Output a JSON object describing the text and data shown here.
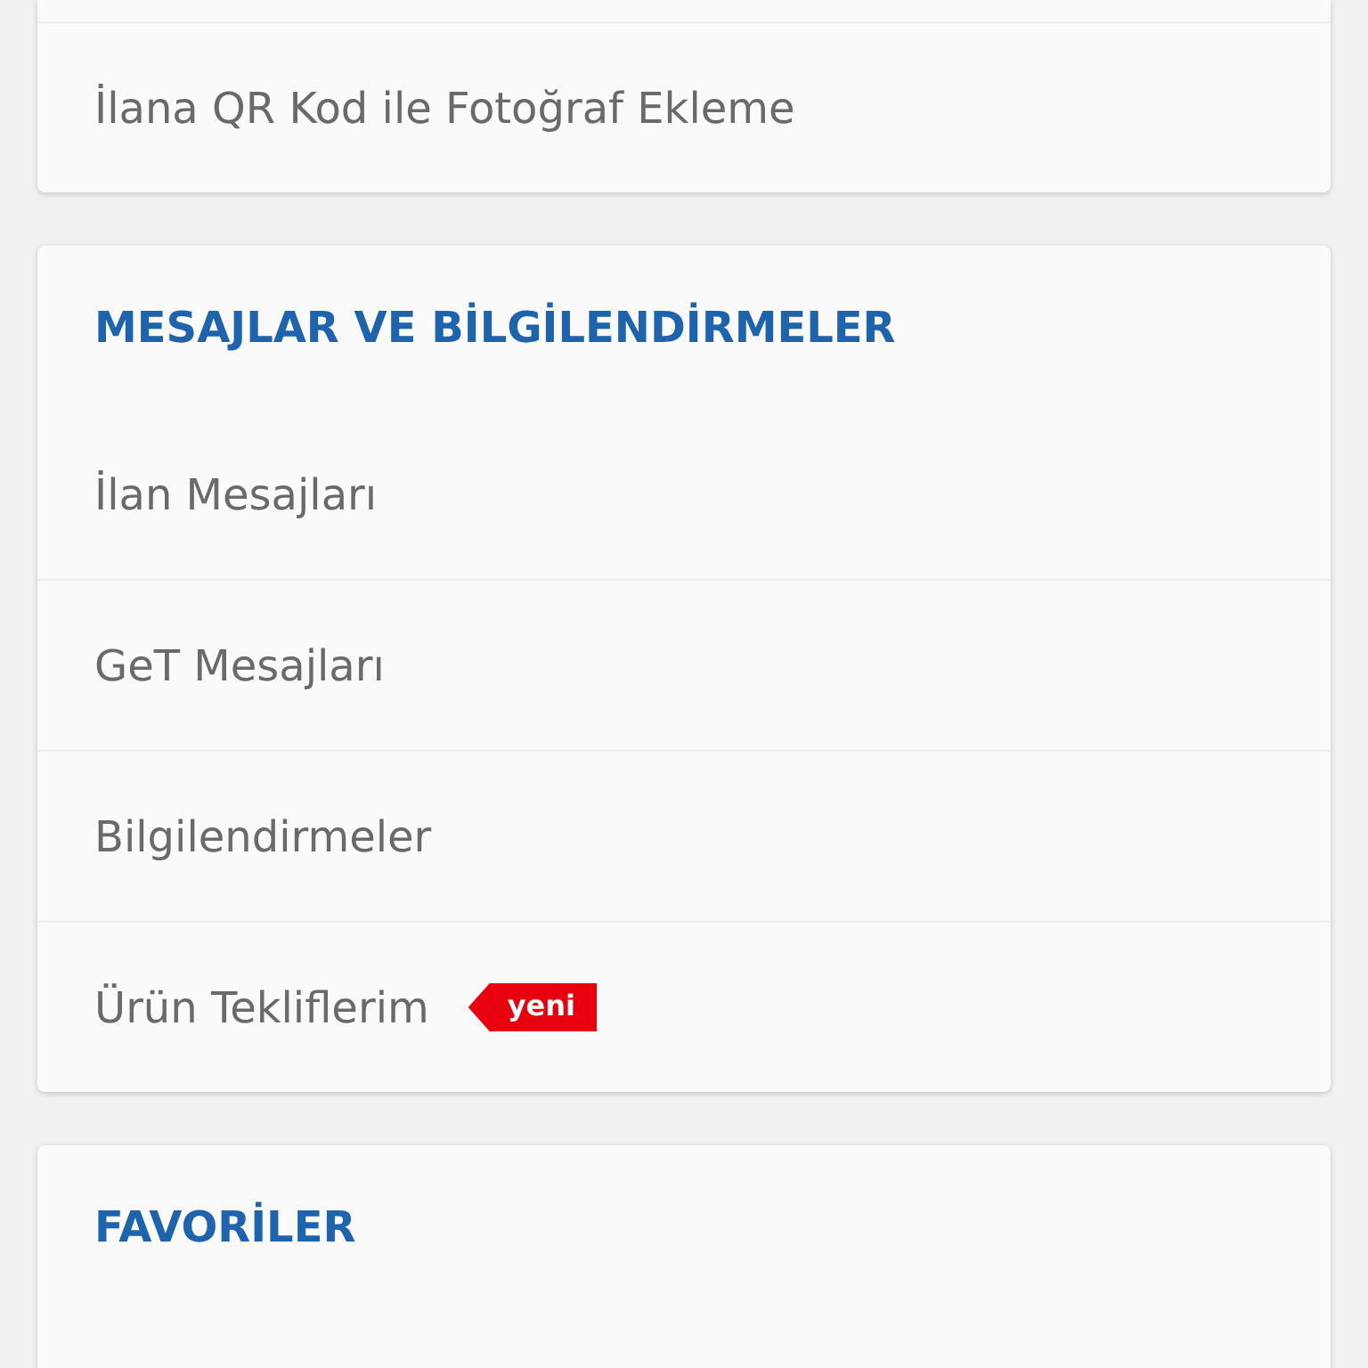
{
  "sections": [
    {
      "items": [
        {
          "label": "İlana QR Kod ile Fotoğraf Ekleme"
        }
      ]
    },
    {
      "title": "MESAJLAR VE BİLGİLENDİRMELER",
      "items": [
        {
          "label": "İlan Mesajları"
        },
        {
          "label": "GeT Mesajları"
        },
        {
          "label": "Bilgilendirmeler"
        },
        {
          "label": "Ürün Tekliflerim",
          "badge": "yeni"
        }
      ]
    },
    {
      "title": "FAVORİLER"
    }
  ]
}
